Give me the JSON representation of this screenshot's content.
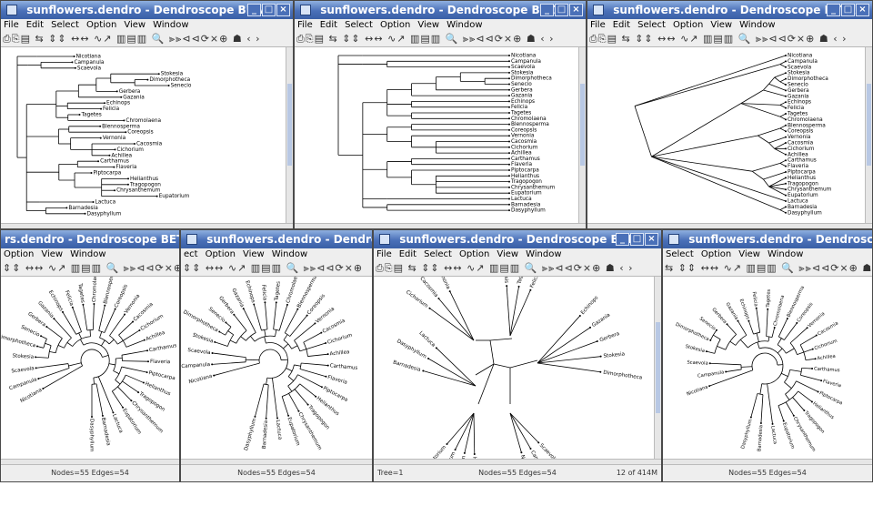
{
  "windows": [
    {
      "title": "sunflowers.dendro - Dendroscope BETA",
      "menu": [
        "File",
        "Edit",
        "Select",
        "Option",
        "View",
        "Window"
      ],
      "toolbar": "⎙⎘▤ ⇆ ⇕⇕ ↔↔ ∿↗ ▥▤▥ 🔍 ⫸⫸⊲⊲⟳⨯⊕ ☗ ‹ ›"
    },
    {
      "title": "sunflowers.dendro - Dendroscope BETA",
      "menu": [
        "File",
        "Edit",
        "Select",
        "Option",
        "View",
        "Window"
      ],
      "toolbar": "⎙⎘▤ ⇆ ⇕⇕ ↔↔ ∿↗ ▥▤▥ 🔍 ⫸⫸⊲⊲⟳⨯⊕ ☗ ‹ ›"
    },
    {
      "title": "sunflowers.dendro - Dendroscope BETA",
      "menu": [
        "File",
        "Edit",
        "Select",
        "Option",
        "View",
        "Window"
      ],
      "toolbar": "⎙⎘▤ ⇆ ⇕⇕ ↔↔ ∿↗ ▥▤▥ 🔍 ⫸⫸⊲⊲⟳⨯⊕ ☗ ‹ ›"
    },
    {
      "title": "rs.dendro - Dendroscope BETA",
      "menu": [
        "Option",
        "View",
        "Window"
      ],
      "toolbar": "⇕⇕ ↔↔ ∿↗ ▥▤▥ 🔍 ⫸⫸⊲⊲⟳⨯⊕",
      "status": "Nodes=55 Edges=54"
    },
    {
      "title": "sunflowers.dendro - Dendroscope",
      "menu": [
        "ect",
        "Option",
        "View",
        "Window"
      ],
      "toolbar": "⇕⇕ ↔↔ ∿↗ ▥▤▥ 🔍 ⫸⫸⊲⊲⟳⨯⊕",
      "status": "Nodes=55 Edges=54"
    },
    {
      "title": "sunflowers.dendro - Dendroscope BETA",
      "menu": [
        "File",
        "Edit",
        "Select",
        "Option",
        "View",
        "Window"
      ],
      "toolbar": "⎙⎘▤ ⇆ ⇕⇕ ↔↔ ∿↗ ▥▤▥ 🔍 ⫸⫸⊲⊲⟳⨯⊕ ☗ ‹ ›",
      "status": "Nodes=55 Edges=54",
      "status_left": "Tree=1",
      "status_right": "12 of 414M"
    },
    {
      "title": "sunflowers.dendro - Dendroscope B",
      "menu": [
        "Select",
        "Option",
        "View",
        "Window"
      ],
      "toolbar": "⇆ ⇕⇕ ↔↔ ∿↗ ▥▤▥ 🔍 ⫸⫸⊲⊲⟳⨯⊕ ☗",
      "status": "Nodes=55 Edges=54"
    }
  ],
  "window_buttons": {
    "minimize": "_",
    "maximize": "□",
    "close": "×"
  },
  "taxa": [
    "Nicotiana",
    "Campanula",
    "Scaevola",
    "Stokesia",
    "Dimorphotheca",
    "Senecio",
    "Gerbera",
    "Gazania",
    "Echinops",
    "Felicia",
    "Tagetes",
    "Chromolaena",
    "Blennosperma",
    "Coreopsis",
    "Vernonia",
    "Cacosmia",
    "Cichorium",
    "Achillea",
    "Carthamus",
    "Flaveria",
    "Piptocarpa",
    "Helianthus",
    "Tragopogon",
    "Chrysanthemum",
    "Eupatorium",
    "Lactuca",
    "Barnadesia",
    "Dasyphyllum"
  ],
  "tree1_taxa": [
    "Nicotiana",
    "Campanula",
    "Scaevola",
    "Stokesia",
    "Dimorphotheca",
    "Senecio",
    "Gerbera",
    "Gazania",
    "Echinops",
    "Felicia",
    "Tagetes",
    "Chromolaena",
    "Coreopsis",
    "Vernonia",
    "Cacosmia",
    "Cichorium",
    "Achillea",
    "Carthamus",
    "Flaveria",
    "Piptocarpa",
    "Helianthus",
    "Tragopogon",
    "Chrysanthemum",
    "Eupatorium",
    "Lactuca",
    "Barnadesia",
    "Dasyphyllum"
  ],
  "colors": {
    "titlebar": "#4a70b8",
    "chrome": "#eeeeee",
    "edge": "#000000"
  }
}
